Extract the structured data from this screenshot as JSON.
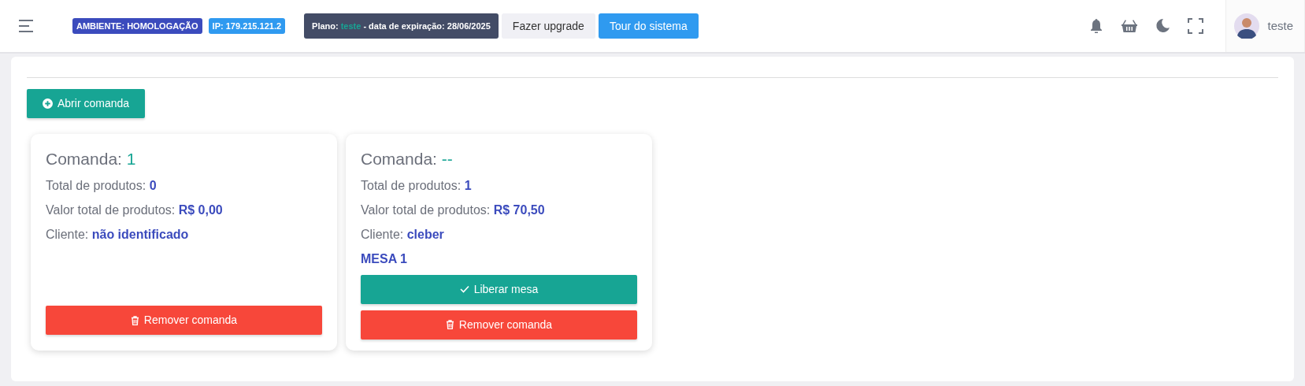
{
  "header": {
    "environment": "AMBIENTE: HOMOLOGAÇÃO",
    "ip": "IP: 179.215.121.2",
    "plan": {
      "label": "Plano:",
      "name": "teste",
      "expiry": "- data de expiração: 28/06/2025"
    },
    "buttons": [
      {
        "label": "Fazer upgrade",
        "kind": "light"
      },
      {
        "label": "Tour do sistema",
        "kind": "primary"
      }
    ],
    "user": {
      "name": "teste"
    }
  },
  "open_button": "Abrir comanda",
  "cards": [
    {
      "title": "Comanda:",
      "number": "1",
      "fields": [
        {
          "label": "Total de produtos:",
          "value": "0"
        },
        {
          "label": "Valor total de produtos:",
          "value": "R$ 0,00"
        },
        {
          "label": "Cliente:",
          "value": "não identificado"
        }
      ],
      "buttons": [
        {
          "label": "Remover comanda",
          "kind": "remove"
        }
      ]
    },
    {
      "title": "Comanda:",
      "number": "--",
      "fields": [
        {
          "label": "Total de produtos:",
          "value": "1"
        },
        {
          "label": "Valor total de produtos:",
          "value": "R$ 70,50"
        },
        {
          "label": "Cliente:",
          "value": "cleber"
        }
      ],
      "table": "MESA 1",
      "buttons": [
        {
          "label": "Liberar mesa",
          "kind": "release"
        },
        {
          "label": "Remover comanda",
          "kind": "remove"
        }
      ]
    }
  ]
}
